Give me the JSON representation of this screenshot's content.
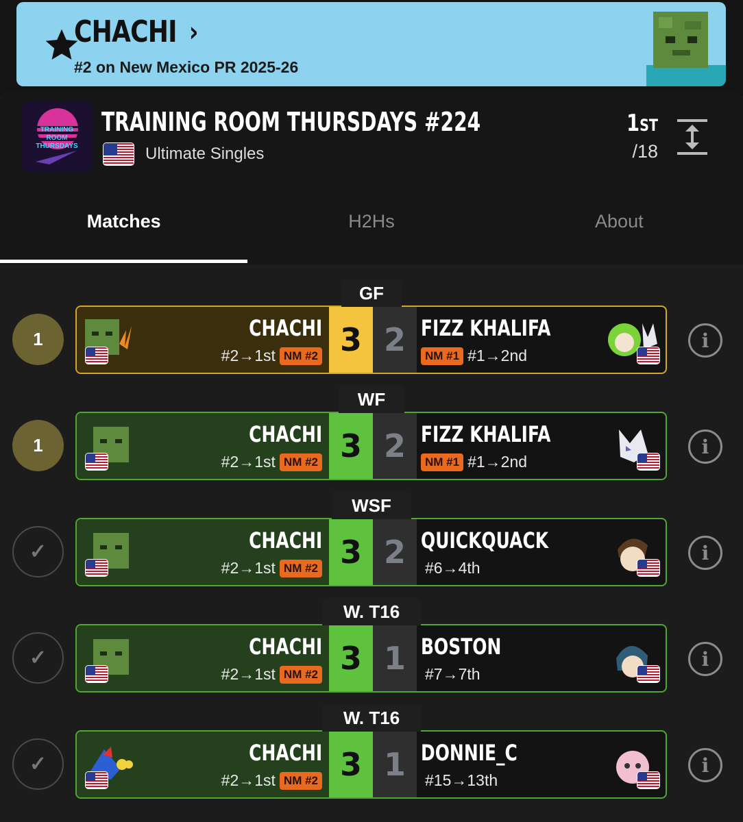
{
  "banner": {
    "player": "CHACHI",
    "chevron": "›",
    "pr_line": "#2 on New Mexico PR 2025-26",
    "star_icon": "star-icon",
    "bg": "#8dd3ef"
  },
  "tournament": {
    "title": "TRAINING ROOM THURSDAYS #224",
    "game": "Ultimate Singles",
    "placement": "1",
    "placement_suffix": "ST",
    "entrants": "/18",
    "logo_text": "TRAINING ROOM THURSDAYS"
  },
  "tabs": [
    {
      "label": "Matches",
      "active": true
    },
    {
      "label": "H2Hs",
      "active": false
    },
    {
      "label": "About",
      "active": false
    }
  ],
  "matches": [
    {
      "round": "GF",
      "seed_marker": "1",
      "style": "gold",
      "left_name": "CHACHI",
      "left_seed": "#2→1st",
      "left_badge": "NM #2",
      "left_score": "3",
      "right_score": "2",
      "right_name": "FIZZ KHALIFA",
      "right_badge": "NM #1",
      "right_seed": "#1→2nd"
    },
    {
      "round": "WF",
      "seed_marker": "1",
      "style": "green",
      "left_name": "CHACHI",
      "left_seed": "#2→1st",
      "left_badge": "NM #2",
      "left_score": "3",
      "right_score": "2",
      "right_name": "FIZZ KHALIFA",
      "right_badge": "NM #1",
      "right_seed": "#1→2nd"
    },
    {
      "round": "WSF",
      "seed_marker": "✓",
      "style": "green",
      "left_name": "CHACHI",
      "left_seed": "#2→1st",
      "left_badge": "NM #2",
      "left_score": "3",
      "right_score": "2",
      "right_name": "QUICKQUACK",
      "right_badge": "",
      "right_seed": "#6→4th"
    },
    {
      "round": "W. T16",
      "seed_marker": "✓",
      "style": "green",
      "left_name": "CHACHI",
      "left_seed": "#2→1st",
      "left_badge": "NM #2",
      "left_score": "3",
      "right_score": "1",
      "right_name": "BOSTON",
      "right_badge": "",
      "right_seed": "#7→7th"
    },
    {
      "round": "W. T16",
      "seed_marker": "✓",
      "style": "green",
      "left_name": "CHACHI",
      "left_seed": "#2→1st",
      "left_badge": "NM #2",
      "left_score": "3",
      "right_score": "1",
      "right_name": "DONNIE_C",
      "right_badge": "",
      "right_seed": "#15→13th"
    }
  ],
  "colors": {
    "gold_accent": "#f4c43c",
    "green_accent": "#5fc23f",
    "badge_orange": "#e96a1e",
    "background": "#1c1c1c"
  }
}
